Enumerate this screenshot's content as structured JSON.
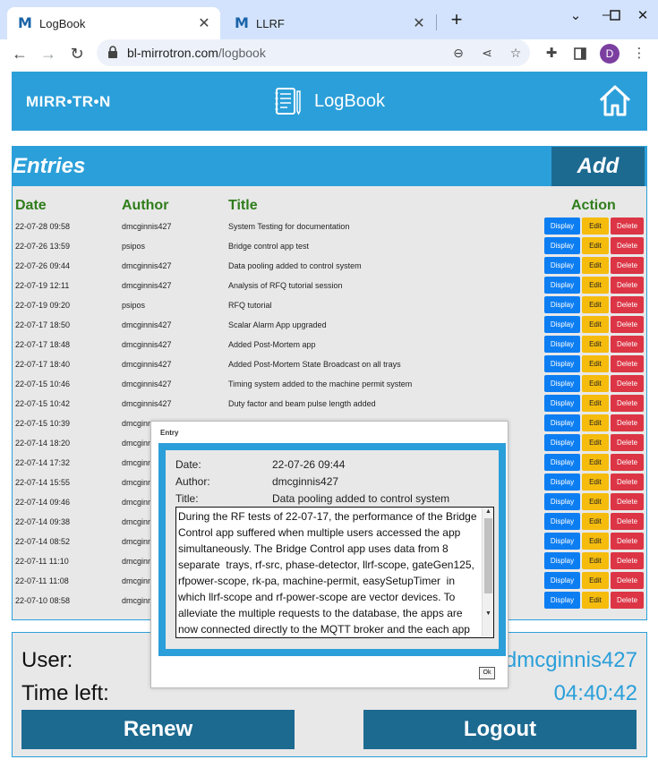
{
  "browser": {
    "tabs": [
      {
        "label": "LogBook",
        "favicon": "M"
      },
      {
        "label": "LLRF",
        "favicon": "M"
      }
    ],
    "new_tab": "+",
    "address": {
      "host": "bl-mirrotron.com",
      "path": "/logbook"
    },
    "profile_initial": "D"
  },
  "header": {
    "brand": "MIRR•TR•N",
    "title": "LogBook"
  },
  "entries": {
    "title": "Entries",
    "add_label": "Add",
    "columns": {
      "date": "Date",
      "author": "Author",
      "title": "Title",
      "action": "Action"
    },
    "actions": {
      "display": "Display",
      "edit": "Edit",
      "delete": "Delete"
    },
    "rows": [
      {
        "date": "22-07-28 09:58",
        "author": "dmcginnis427",
        "title": "System Testing for documentation"
      },
      {
        "date": "22-07-26 13:59",
        "author": "psipos",
        "title": "Bridge control app test"
      },
      {
        "date": "22-07-26 09:44",
        "author": "dmcginnis427",
        "title": "Data pooling added to control system"
      },
      {
        "date": "22-07-19 12:11",
        "author": "dmcginnis427",
        "title": "Analysis of RFQ tutorial session"
      },
      {
        "date": "22-07-19 09:20",
        "author": "psipos",
        "title": "RFQ tutorial"
      },
      {
        "date": "22-07-17 18:50",
        "author": "dmcginnis427",
        "title": "Scalar Alarm App upgraded"
      },
      {
        "date": "22-07-17 18:48",
        "author": "dmcginnis427",
        "title": "Added Post-Mortem app"
      },
      {
        "date": "22-07-17 18:40",
        "author": "dmcginnis427",
        "title": "Added Post-Mortem State Broadcast on all trays"
      },
      {
        "date": "22-07-15 10:46",
        "author": "dmcginnis427",
        "title": "Timing system added to the machine permit system"
      },
      {
        "date": "22-07-15 10:42",
        "author": "dmcginnis427",
        "title": "Duty factor and beam pulse length added"
      },
      {
        "date": "22-07-15 10:39",
        "author": "dmcginn",
        "title": ""
      },
      {
        "date": "22-07-14 18:20",
        "author": "dmcginn",
        "title": ""
      },
      {
        "date": "22-07-14 17:32",
        "author": "dmcginn",
        "title": ""
      },
      {
        "date": "22-07-14 15:55",
        "author": "dmcginn",
        "title": ""
      },
      {
        "date": "22-07-14 09:46",
        "author": "dmcginn",
        "title": ""
      },
      {
        "date": "22-07-14 09:38",
        "author": "dmcginn",
        "title": ""
      },
      {
        "date": "22-07-14 08:52",
        "author": "dmcginn",
        "title": ""
      },
      {
        "date": "22-07-11 11:10",
        "author": "dmcginn",
        "title": ""
      },
      {
        "date": "22-07-11 11:08",
        "author": "dmcginn",
        "title": ""
      },
      {
        "date": "22-07-10 08:58",
        "author": "dmcginn",
        "title": ""
      }
    ]
  },
  "user_panel": {
    "user_label": "User:",
    "user_value": "dmcginnis427",
    "time_label": "Time left:",
    "time_value": "04:40:42",
    "renew_label": "Renew",
    "logout_label": "Logout"
  },
  "modal": {
    "title": "Entry",
    "date_label": "Date:",
    "date_value": "22-07-26 09:44",
    "author_label": "Author:",
    "author_value": "dmcginnis427",
    "title_label": "Title:",
    "title_value": "Data pooling added to control system",
    "body": "During the RF tests of 22-07-17, the performance of the Bridge Control app suffered when multiple users accessed the app simultaneously. The Bridge Control app uses data from 8 separate  trays, rf-src, phase-detector, llrf-scope, gateGen125, rfpower-scope, rk-pa, machine-permit, easySetupTimer  in which llrf-scope and rf-power-scope are vector devices. To alleviate the multiple requests to the database, the apps are now connected directly to the MQTT broker and the each app has its own",
    "ok_label": "Ok"
  },
  "colors": {
    "primary": "#2b9fd9",
    "dark_button": "#1d6a91",
    "column_header": "#2e7d1a",
    "display": "#0d7ef2",
    "edit": "#f5bc0e",
    "delete": "#dc3545"
  }
}
